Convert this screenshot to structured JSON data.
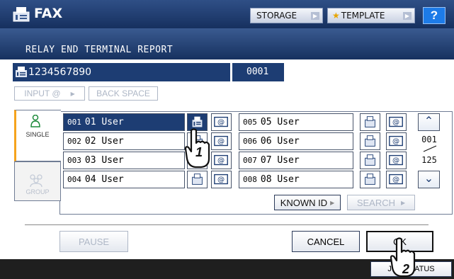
{
  "header": {
    "title": "FAX",
    "storage_label": "STORAGE",
    "template_label": "TEMPLATE",
    "help_label": "?"
  },
  "subheader": {
    "title": "RELAY END TERMINAL REPORT"
  },
  "number_bar": {
    "number": "1234567890",
    "sequence": "0001"
  },
  "input_buttons": {
    "input_at": "INPUT @",
    "backspace": "BACK SPACE"
  },
  "tabs": [
    {
      "label": "SINGLE",
      "active": true
    },
    {
      "label": "GROUP",
      "active": false
    }
  ],
  "entries": [
    {
      "num": "001",
      "name": "01 User",
      "selected": true
    },
    {
      "num": "002",
      "name": "02 User",
      "selected": false
    },
    {
      "num": "003",
      "name": "03 User",
      "selected": false
    },
    {
      "num": "004",
      "name": "04 User",
      "selected": false
    },
    {
      "num": "005",
      "name": "05 User",
      "selected": false
    },
    {
      "num": "006",
      "name": "06 User",
      "selected": false
    },
    {
      "num": "007",
      "name": "07 User",
      "selected": false
    },
    {
      "num": "008",
      "name": "08 User",
      "selected": false
    }
  ],
  "pagination": {
    "current": "001",
    "total": "125"
  },
  "actions": {
    "known_id": "KNOWN ID",
    "search": "SEARCH"
  },
  "footer_buttons": {
    "pause": "PAUSE",
    "cancel": "CANCEL",
    "ok": "OK",
    "job_status": "JOB STATUS"
  },
  "callouts": {
    "step1": "1",
    "step2": "2"
  },
  "colors": {
    "header": "#16305f",
    "selected": "#1d3d73",
    "accent": "#f6a31c",
    "help": "#1d7be8"
  }
}
